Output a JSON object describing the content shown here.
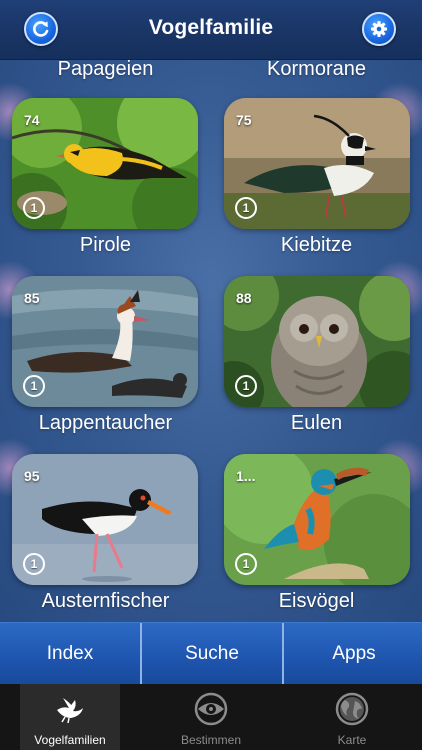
{
  "header": {
    "title": "Vogelfamilie",
    "refresh_icon": "refresh-icon",
    "settings_icon": "gear-icon"
  },
  "partial_row": {
    "left": "Papageien",
    "right": "Kormorane"
  },
  "families": [
    {
      "name": "Pirole",
      "count": "74",
      "badge": "1"
    },
    {
      "name": "Kiebitze",
      "count": "75",
      "badge": "1"
    },
    {
      "name": "Lappentaucher",
      "count": "85",
      "badge": "1"
    },
    {
      "name": "Eulen",
      "count": "88",
      "badge": "1"
    },
    {
      "name": "Austernfischer",
      "count": "95",
      "badge": "1"
    },
    {
      "name": "Eisvögel",
      "count": "1...",
      "badge": "1"
    }
  ],
  "segments": {
    "index": "Index",
    "suche": "Suche",
    "apps": "Apps"
  },
  "tabs": [
    {
      "label": "Vogelfamilien",
      "icon": "bird-icon",
      "active": true
    },
    {
      "label": "Bestimmen",
      "icon": "eye-icon",
      "active": false
    },
    {
      "label": "Karte",
      "icon": "globe-icon",
      "active": false
    }
  ],
  "colors": {
    "accent": "#1767e0",
    "segment_bar": "#1f56b0",
    "tab_active": "#ffffff",
    "tab_inactive": "#8c8c8c"
  }
}
